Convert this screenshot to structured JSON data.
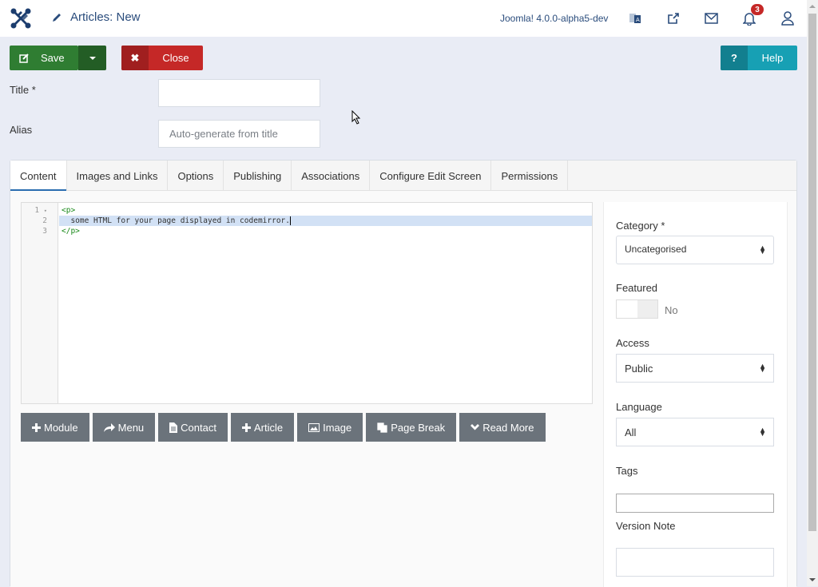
{
  "header": {
    "logo": "joomla-logo",
    "title_icon": "pencil-icon",
    "title": "Articles: New",
    "version": "Joomla! 4.0.0-alpha5-dev",
    "icons": [
      "translate-icon",
      "external-link-icon",
      "envelope-icon",
      "bell-icon",
      "user-icon"
    ],
    "notification_count": "3"
  },
  "toolbar": {
    "save_label": "Save",
    "close_label": "Close",
    "help_label": "Help",
    "help_icon_glyph": "?",
    "close_icon_glyph": "✖"
  },
  "form": {
    "title_label": "Title *",
    "title_value": "",
    "alias_label": "Alias",
    "alias_placeholder": "Auto-generate from title"
  },
  "tabs": [
    {
      "label": "Content",
      "active": true
    },
    {
      "label": "Images and Links"
    },
    {
      "label": "Options"
    },
    {
      "label": "Publishing"
    },
    {
      "label": "Associations"
    },
    {
      "label": "Configure Edit Screen"
    },
    {
      "label": "Permissions"
    }
  ],
  "editor": {
    "lines": [
      {
        "num": "1",
        "fold": "▾",
        "open": "<p>"
      },
      {
        "num": "2",
        "text": "  some HTML for your page displayed in codemirror."
      },
      {
        "num": "3",
        "close": "</p>"
      }
    ],
    "buttons": [
      {
        "label": "Module",
        "icon": "plus-icon"
      },
      {
        "label": "Menu",
        "icon": "share-icon"
      },
      {
        "label": "Contact",
        "icon": "file-icon"
      },
      {
        "label": "Article",
        "icon": "plus-icon"
      },
      {
        "label": "Image",
        "icon": "image-icon"
      },
      {
        "label": "Page Break",
        "icon": "copy-icon"
      },
      {
        "label": "Read More",
        "icon": "chevron-down-icon"
      }
    ]
  },
  "sidebar": {
    "category_label": "Category *",
    "category_value": "Uncategorised",
    "featured_label": "Featured",
    "featured_value": "No",
    "access_label": "Access",
    "access_value": "Public",
    "language_label": "Language",
    "language_value": "All",
    "tags_label": "Tags",
    "version_note_label": "Version Note"
  },
  "colors": {
    "save": "#2f7d32",
    "close": "#c52827",
    "help": "#17a0b4",
    "header_text": "#2a4c7c",
    "editor_button": "#6b737b"
  }
}
